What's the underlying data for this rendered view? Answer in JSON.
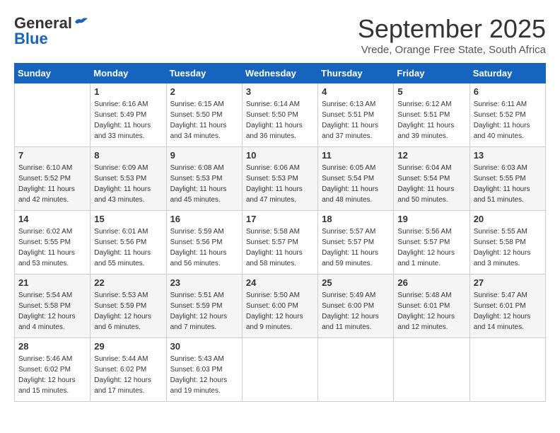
{
  "header": {
    "logo_line1": "General",
    "logo_line2": "Blue",
    "month": "September 2025",
    "location": "Vrede, Orange Free State, South Africa"
  },
  "days_of_week": [
    "Sunday",
    "Monday",
    "Tuesday",
    "Wednesday",
    "Thursday",
    "Friday",
    "Saturday"
  ],
  "weeks": [
    [
      {
        "day": "",
        "info": ""
      },
      {
        "day": "1",
        "info": "Sunrise: 6:16 AM\nSunset: 5:49 PM\nDaylight: 11 hours\nand 33 minutes."
      },
      {
        "day": "2",
        "info": "Sunrise: 6:15 AM\nSunset: 5:50 PM\nDaylight: 11 hours\nand 34 minutes."
      },
      {
        "day": "3",
        "info": "Sunrise: 6:14 AM\nSunset: 5:50 PM\nDaylight: 11 hours\nand 36 minutes."
      },
      {
        "day": "4",
        "info": "Sunrise: 6:13 AM\nSunset: 5:51 PM\nDaylight: 11 hours\nand 37 minutes."
      },
      {
        "day": "5",
        "info": "Sunrise: 6:12 AM\nSunset: 5:51 PM\nDaylight: 11 hours\nand 39 minutes."
      },
      {
        "day": "6",
        "info": "Sunrise: 6:11 AM\nSunset: 5:52 PM\nDaylight: 11 hours\nand 40 minutes."
      }
    ],
    [
      {
        "day": "7",
        "info": "Sunrise: 6:10 AM\nSunset: 5:52 PM\nDaylight: 11 hours\nand 42 minutes."
      },
      {
        "day": "8",
        "info": "Sunrise: 6:09 AM\nSunset: 5:53 PM\nDaylight: 11 hours\nand 43 minutes."
      },
      {
        "day": "9",
        "info": "Sunrise: 6:08 AM\nSunset: 5:53 PM\nDaylight: 11 hours\nand 45 minutes."
      },
      {
        "day": "10",
        "info": "Sunrise: 6:06 AM\nSunset: 5:53 PM\nDaylight: 11 hours\nand 47 minutes."
      },
      {
        "day": "11",
        "info": "Sunrise: 6:05 AM\nSunset: 5:54 PM\nDaylight: 11 hours\nand 48 minutes."
      },
      {
        "day": "12",
        "info": "Sunrise: 6:04 AM\nSunset: 5:54 PM\nDaylight: 11 hours\nand 50 minutes."
      },
      {
        "day": "13",
        "info": "Sunrise: 6:03 AM\nSunset: 5:55 PM\nDaylight: 11 hours\nand 51 minutes."
      }
    ],
    [
      {
        "day": "14",
        "info": "Sunrise: 6:02 AM\nSunset: 5:55 PM\nDaylight: 11 hours\nand 53 minutes."
      },
      {
        "day": "15",
        "info": "Sunrise: 6:01 AM\nSunset: 5:56 PM\nDaylight: 11 hours\nand 55 minutes."
      },
      {
        "day": "16",
        "info": "Sunrise: 5:59 AM\nSunset: 5:56 PM\nDaylight: 11 hours\nand 56 minutes."
      },
      {
        "day": "17",
        "info": "Sunrise: 5:58 AM\nSunset: 5:57 PM\nDaylight: 11 hours\nand 58 minutes."
      },
      {
        "day": "18",
        "info": "Sunrise: 5:57 AM\nSunset: 5:57 PM\nDaylight: 11 hours\nand 59 minutes."
      },
      {
        "day": "19",
        "info": "Sunrise: 5:56 AM\nSunset: 5:57 PM\nDaylight: 12 hours\nand 1 minute."
      },
      {
        "day": "20",
        "info": "Sunrise: 5:55 AM\nSunset: 5:58 PM\nDaylight: 12 hours\nand 3 minutes."
      }
    ],
    [
      {
        "day": "21",
        "info": "Sunrise: 5:54 AM\nSunset: 5:58 PM\nDaylight: 12 hours\nand 4 minutes."
      },
      {
        "day": "22",
        "info": "Sunrise: 5:53 AM\nSunset: 5:59 PM\nDaylight: 12 hours\nand 6 minutes."
      },
      {
        "day": "23",
        "info": "Sunrise: 5:51 AM\nSunset: 5:59 PM\nDaylight: 12 hours\nand 7 minutes."
      },
      {
        "day": "24",
        "info": "Sunrise: 5:50 AM\nSunset: 6:00 PM\nDaylight: 12 hours\nand 9 minutes."
      },
      {
        "day": "25",
        "info": "Sunrise: 5:49 AM\nSunset: 6:00 PM\nDaylight: 12 hours\nand 11 minutes."
      },
      {
        "day": "26",
        "info": "Sunrise: 5:48 AM\nSunset: 6:01 PM\nDaylight: 12 hours\nand 12 minutes."
      },
      {
        "day": "27",
        "info": "Sunrise: 5:47 AM\nSunset: 6:01 PM\nDaylight: 12 hours\nand 14 minutes."
      }
    ],
    [
      {
        "day": "28",
        "info": "Sunrise: 5:46 AM\nSunset: 6:02 PM\nDaylight: 12 hours\nand 15 minutes."
      },
      {
        "day": "29",
        "info": "Sunrise: 5:44 AM\nSunset: 6:02 PM\nDaylight: 12 hours\nand 17 minutes."
      },
      {
        "day": "30",
        "info": "Sunrise: 5:43 AM\nSunset: 6:03 PM\nDaylight: 12 hours\nand 19 minutes."
      },
      {
        "day": "",
        "info": ""
      },
      {
        "day": "",
        "info": ""
      },
      {
        "day": "",
        "info": ""
      },
      {
        "day": "",
        "info": ""
      }
    ]
  ]
}
